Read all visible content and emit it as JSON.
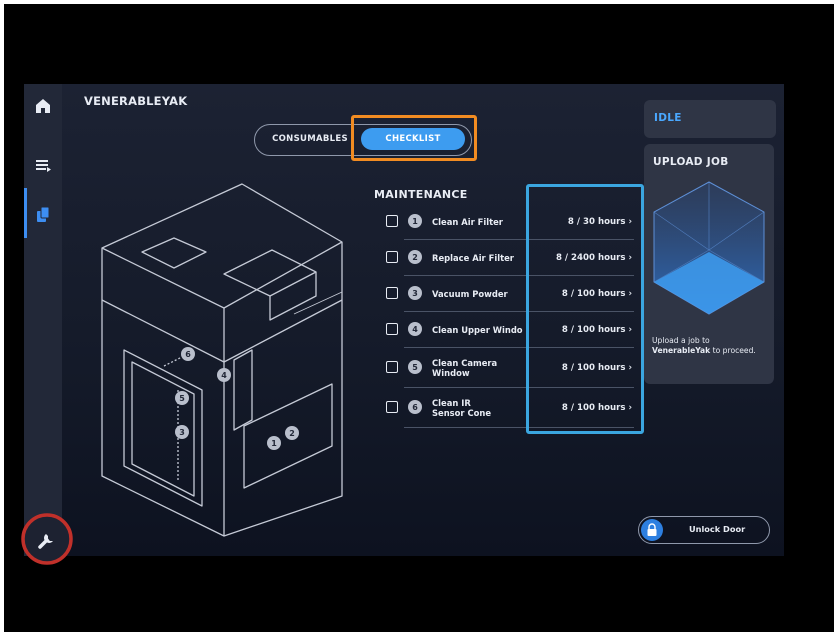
{
  "device_name": "VENERABLEYAK",
  "tabs": {
    "consumables": "CONSUMABLES",
    "checklist": "CHECKLIST",
    "active": "CHECKLIST"
  },
  "maintenance": {
    "title": "MAINTENANCE",
    "items": [
      {
        "num": "1",
        "label": "Clean Air Filter",
        "value": "8 / 30 hours"
      },
      {
        "num": "2",
        "label": "Replace Air Filter",
        "value": "8 / 2400 hours"
      },
      {
        "num": "3",
        "label": "Vacuum Powder",
        "value": "8 / 100 hours"
      },
      {
        "num": "4",
        "label": "Clean Upper Windo",
        "value": "8 / 100 hours"
      },
      {
        "num": "5",
        "label": "Clean Camera Window",
        "value": "8 / 100 hours"
      },
      {
        "num": "6",
        "label": "Clean IR Sensor Cone",
        "value": "8 / 100 hours"
      }
    ],
    "chevron": "›"
  },
  "status": {
    "label": "IDLE",
    "color": "#4aa8ff"
  },
  "upload": {
    "title": "UPLOAD JOB",
    "text_before": "Upload a job to",
    "printer": "VenerableYak",
    "text_after": "to proceed."
  },
  "unlock_button": {
    "label": "Unlock Door"
  },
  "diagram_labels": [
    "1",
    "2",
    "3",
    "4",
    "5",
    "6"
  ],
  "icons": {
    "nav": [
      "home-icon",
      "queue-icon",
      "materials-icon"
    ],
    "service": "wrench-icon",
    "lock": "lock-icon",
    "upload": "cube-icon"
  },
  "colors": {
    "accent": "#3d9cf0",
    "highlight_orange": "#f28c22",
    "highlight_blue": "#3ba6e0",
    "highlight_red": "#c0302a"
  }
}
